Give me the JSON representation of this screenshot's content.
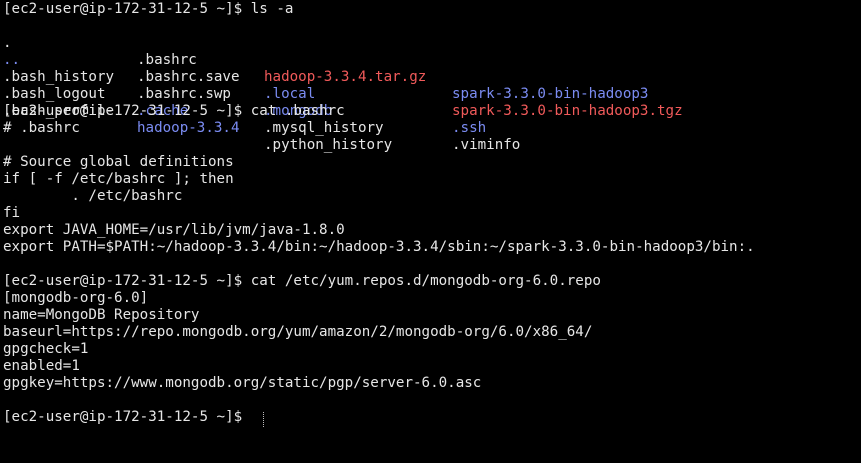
{
  "colors": {
    "background": "#000000",
    "foreground": "#e6e6e6",
    "directory": "#7b8cf2",
    "archive": "#f05a5a"
  },
  "terminal": {
    "prompt1": "[ec2-user@ip-172-31-12-5 ~]$ ls -a",
    "ls_rows": [
      [
        {
          "text": ".",
          "color": "plain"
        },
        {
          "text": ".bashrc",
          "color": "plain"
        },
        {
          "text": "hadoop-3.3.4.tar.gz",
          "color": "red"
        },
        {
          "text": "spark-3.3.0-bin-hadoop3",
          "color": "blue"
        }
      ],
      [
        {
          "text": "..",
          "color": "blue"
        },
        {
          "text": ".bashrc.save",
          "color": "plain"
        },
        {
          "text": ".local",
          "color": "blue"
        },
        {
          "text": "spark-3.3.0-bin-hadoop3.tgz",
          "color": "red"
        }
      ],
      [
        {
          "text": ".bash_history",
          "color": "plain"
        },
        {
          "text": ".bashrc.swp",
          "color": "plain"
        },
        {
          "text": ".mongodb",
          "color": "blue"
        },
        {
          "text": ".ssh",
          "color": "blue"
        }
      ],
      [
        {
          "text": ".bash_logout",
          "color": "plain"
        },
        {
          "text": ".cache",
          "color": "blue"
        },
        {
          "text": ".mysql_history",
          "color": "plain"
        },
        {
          "text": ".viminfo",
          "color": "plain"
        }
      ],
      [
        {
          "text": ".bash_profile",
          "color": "plain"
        },
        {
          "text": "hadoop-3.3.4",
          "color": "blue"
        },
        {
          "text": ".python_history",
          "color": "plain"
        },
        {
          "text": "",
          "color": "plain"
        }
      ]
    ],
    "prompt2": "[ec2-user@ip-172-31-12-5 ~]$ cat .bashrc",
    "bashrc_lines": [
      "# .bashrc",
      "",
      "# Source global definitions",
      "if [ -f /etc/bashrc ]; then",
      "        . /etc/bashrc",
      "fi",
      "export JAVA_HOME=/usr/lib/jvm/java-1.8.0",
      "export PATH=$PATH:~/hadoop-3.3.4/bin:~/hadoop-3.3.4/sbin:~/spark-3.3.0-bin-hadoop3/bin:.",
      ""
    ],
    "prompt3": "[ec2-user@ip-172-31-12-5 ~]$ cat /etc/yum.repos.d/mongodb-org-6.0.repo",
    "repo_lines": [
      "[mongodb-org-6.0]",
      "name=MongoDB Repository",
      "baseurl=https://repo.mongodb.org/yum/amazon/2/mongodb-org/6.0/x86_64/",
      "gpgcheck=1",
      "enabled=1",
      "gpgkey=https://www.mongodb.org/static/pgp/server-6.0.asc",
      ""
    ],
    "prompt4": "[ec2-user@ip-172-31-12-5 ~]$ "
  }
}
